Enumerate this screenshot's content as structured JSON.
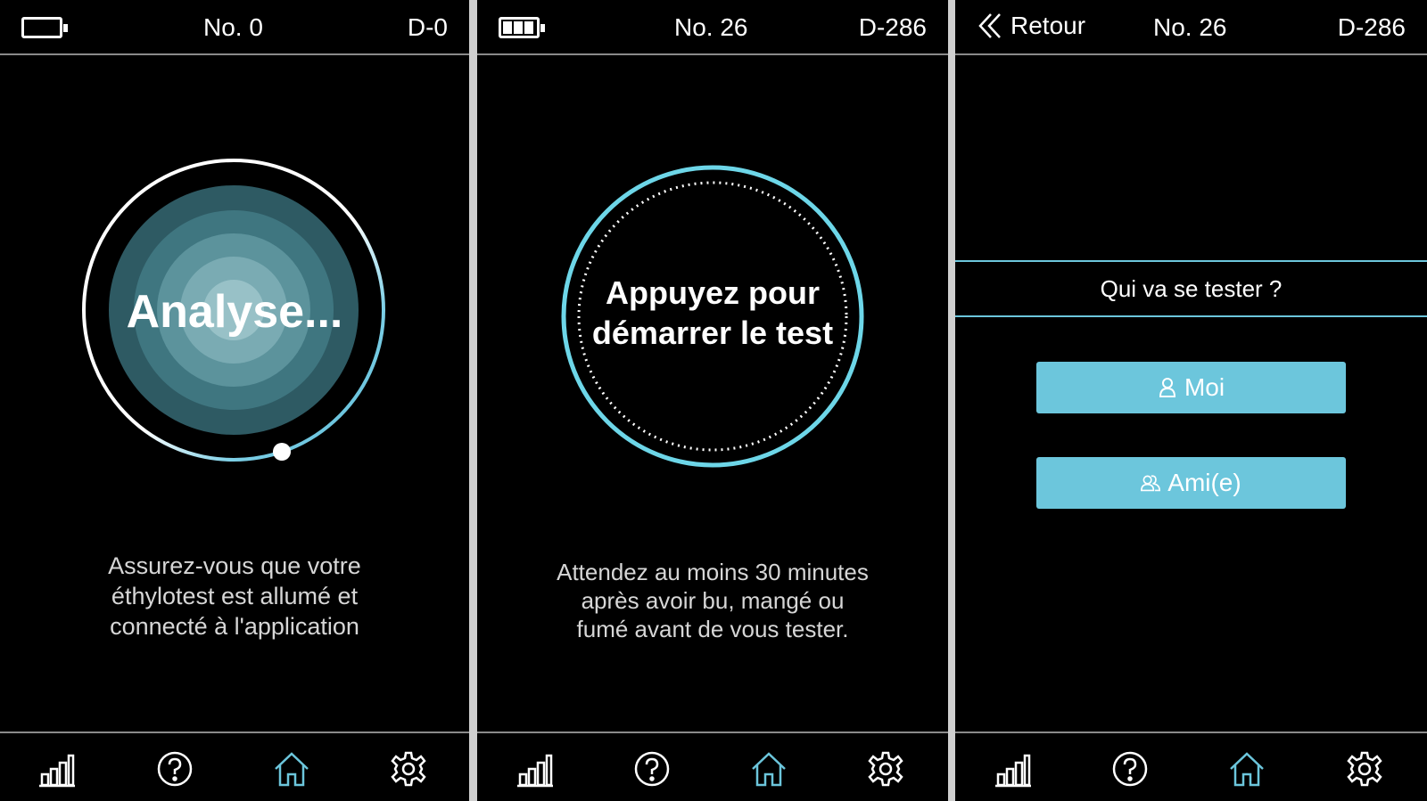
{
  "screens": [
    {
      "header": {
        "number": "No. 0",
        "device": "D-0",
        "battery_level": 0
      },
      "center_label": "Analyse...",
      "caption": [
        "Assurez-vous que votre",
        "éthylotest est allumé et",
        "connecté à l'application"
      ]
    },
    {
      "header": {
        "number": "No. 26",
        "device": "D-286",
        "battery_level": 1
      },
      "center_label": [
        "Appuyez pour",
        "démarrer le test"
      ],
      "caption": [
        "Attendez au moins 30 minutes",
        "après avoir bu, mangé ou",
        "fumé avant de vous tester."
      ]
    },
    {
      "header": {
        "back_label": "Retour",
        "number": "No. 26",
        "device": "D-286"
      },
      "question": "Qui va se tester ?",
      "buttons": {
        "self": "Moi",
        "friend": "Ami(e)"
      }
    }
  ],
  "nav": {
    "items": [
      "stats-icon",
      "help-icon",
      "home-icon",
      "settings-icon"
    ],
    "active": "home-icon"
  },
  "colors": {
    "accent": "#6cc6dc",
    "background": "#000000",
    "text": "#ffffff",
    "caption": "#d6d6d6"
  }
}
